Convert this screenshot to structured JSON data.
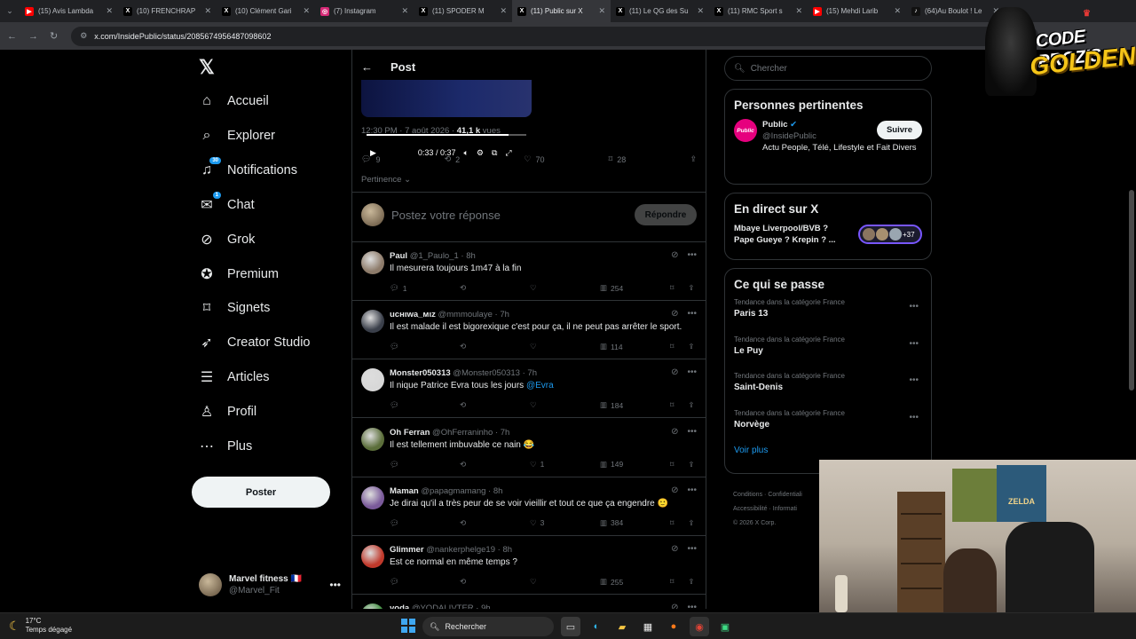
{
  "browser": {
    "tabs": [
      {
        "title": "(15) Avis Lambda",
        "icon": "youtube-icon",
        "color": "#ff0000",
        "active": false
      },
      {
        "title": "(10) FRENCHRAP",
        "icon": "x-icon",
        "color": "#000000",
        "active": false
      },
      {
        "title": "(10) Clément Gari",
        "icon": "x-icon",
        "color": "#000000",
        "active": false
      },
      {
        "title": "(7) Instagram",
        "icon": "instagram-icon",
        "color": "#d62976",
        "active": false
      },
      {
        "title": "(11) SPODER M",
        "icon": "x-icon",
        "color": "#000000",
        "active": false
      },
      {
        "title": "(11) Public sur X",
        "icon": "x-icon",
        "color": "#000000",
        "active": true
      },
      {
        "title": "(11) Le QG des Su",
        "icon": "x-icon",
        "color": "#000000",
        "active": false
      },
      {
        "title": "(11) RMC Sport s",
        "icon": "x-icon",
        "color": "#000000",
        "active": false
      },
      {
        "title": "(15) Mehdi Larib",
        "icon": "youtube-icon",
        "color": "#ff0000",
        "active": false
      },
      {
        "title": "(64)Au Boulot ! Le",
        "icon": "tiktok-icon",
        "color": "#111111",
        "active": false
      }
    ],
    "url": "x.com/InsidePublic/status/2085674956487098602"
  },
  "nav": {
    "items": [
      {
        "label": "Accueil",
        "icon": "home-icon"
      },
      {
        "label": "Explorer",
        "icon": "search-icon"
      },
      {
        "label": "Notifications",
        "icon": "bell-icon",
        "badge": "30"
      },
      {
        "label": "Chat",
        "icon": "chat-icon",
        "badge": "1"
      },
      {
        "label": "Grok",
        "icon": "grok-icon"
      },
      {
        "label": "Premium",
        "icon": "premium-icon"
      },
      {
        "label": "Signets",
        "icon": "bookmark-icon"
      },
      {
        "label": "Creator Studio",
        "icon": "rocket-icon"
      },
      {
        "label": "Articles",
        "icon": "article-icon"
      },
      {
        "label": "Profil",
        "icon": "person-icon"
      },
      {
        "label": "Plus",
        "icon": "more-circle-icon"
      }
    ],
    "post_label": "Poster",
    "account": {
      "name": "Marvel fitness 🇫🇷",
      "handle": "@Marvel_Fit"
    }
  },
  "post": {
    "header": "Post",
    "video_time": "0:33 / 0:37",
    "video_progress": 0.89,
    "timestamp": "12:30 PM · 7 août 2026 · ",
    "views_count": "41,1 k",
    "views_label": " vues",
    "stats": {
      "replies": "9",
      "reposts": "2",
      "likes": "70",
      "bookmarks": "28"
    },
    "sort_label": "Pertinence",
    "reply_placeholder": "Postez votre réponse",
    "reply_button": "Répondre"
  },
  "replies": [
    {
      "name": "Paul",
      "handle": "@1_Paulo_1",
      "time": "8h",
      "text": "Il mesurera toujours 1m47 à la fin",
      "mention": "",
      "replies": "1",
      "reposts": "",
      "likes": "",
      "views": "254",
      "avatar_color": "#8d7b6a"
    },
    {
      "name": "ucнιwa_мιz",
      "handle": "@mmmoulaye",
      "time": "7h",
      "text": "Il est malade il est bigorexique c'est pour ça, il ne peut pas arrêter le sport.",
      "mention": "",
      "replies": "",
      "reposts": "",
      "likes": "",
      "views": "114",
      "avatar_color": "#3a3f4a"
    },
    {
      "name": "Monster050313",
      "handle": "@Monster050313",
      "time": "7h",
      "text": "Il nique Patrice Evra tous les jours ",
      "mention": "@Evra",
      "replies": "",
      "reposts": "",
      "likes": "",
      "views": "184",
      "avatar_color": "#d8d8d8"
    },
    {
      "name": "Oh Ferran",
      "handle": "@OhFerraninho",
      "time": "7h",
      "text": "Il est tellement imbuvable ce nain 😂",
      "mention": "",
      "replies": "",
      "reposts": "",
      "likes": "1",
      "views": "149",
      "avatar_color": "#5b6e3a"
    },
    {
      "name": "Maman",
      "handle": "@papagmamang",
      "time": "8h",
      "text": "Je dirai qu'il a très peur de se voir vieillir et tout ce que ça engendre 🙂",
      "mention": "",
      "replies": "",
      "reposts": "",
      "likes": "3",
      "views": "384",
      "avatar_color": "#7a5a9a"
    },
    {
      "name": "Glimmer",
      "handle": "@nankerphelge19",
      "time": "8h",
      "text": "Est ce normal en même temps ?",
      "mention": "",
      "replies": "",
      "reposts": "",
      "likes": "",
      "views": "255",
      "avatar_color": "#c0392b"
    },
    {
      "name": "yoda",
      "handle": "@YODALIVTER",
      "time": "9h",
      "text": "",
      "mention": "",
      "replies": "",
      "reposts": "",
      "likes": "",
      "views": "",
      "avatar_color": "#3a8a3a"
    }
  ],
  "sidebar": {
    "search_placeholder": "Chercher",
    "relevant_title": "Personnes pertinentes",
    "person": {
      "name": "Public",
      "handle": "@InsidePublic",
      "bio": "Actu People, Télé, Lifestyle et Fait Divers",
      "logo_text": "Public",
      "follow": "Suivre"
    },
    "live_title": "En direct sur X",
    "live_text": "Mbaye Liverpool/BVB ? Pape Gueye ? Krepin ? ...",
    "live_count": "+37",
    "trends_title": "Ce qui se passe",
    "trends": [
      {
        "category": "Tendance dans la catégorie France",
        "name": "Paris 13"
      },
      {
        "category": "Tendance dans la catégorie France",
        "name": "Le Puy"
      },
      {
        "category": "Tendance dans la catégorie France",
        "name": "Saint-Denis"
      },
      {
        "category": "Tendance dans la catégorie France",
        "name": "Norvège"
      }
    ],
    "see_more": "Voir plus",
    "footer": [
      "Conditions",
      "Confidentiali",
      "Accessibilité",
      "Informati",
      "© 2026 X Corp."
    ]
  },
  "overlay": {
    "logo_line1": "CODE PROZIS",
    "logo_line2": "GOLDENG",
    "poster_text": "ZELDA"
  },
  "taskbar": {
    "temp": "17°C",
    "weather": "Temps dégagé",
    "search": "Rechercher"
  }
}
